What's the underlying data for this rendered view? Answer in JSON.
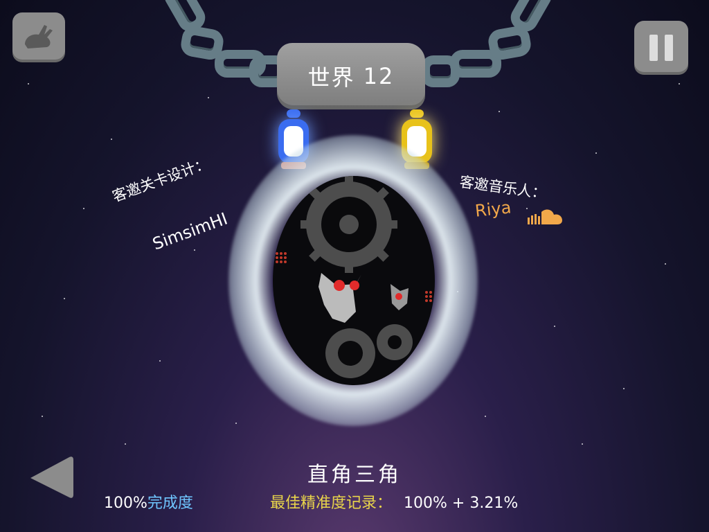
{
  "world_sign": {
    "label": "世界",
    "number": "12"
  },
  "credits": {
    "level_design_label": "客邀关卡设计：",
    "level_designer": "SimsimHI",
    "music_label": "客邀音乐人：",
    "musician": "Riya"
  },
  "level": {
    "name": "直角三角",
    "completion_value": "100%",
    "completion_label": "完成度",
    "best_accuracy_label": "最佳精准度记录：",
    "best_accuracy_value": "100% + 3.21%"
  },
  "icons": {
    "top_left": "rabbit-icon",
    "top_right": "pause-icon",
    "bottom_left": "back-arrow-icon",
    "music_service": "soundcloud-icon"
  },
  "colors": {
    "blue_lantern": "#3a6cf0",
    "yellow_lantern": "#e8c21a",
    "accent_blue": "#6fc6ff",
    "accent_yellow": "#e9d54a",
    "accent_orange": "#f2a84a"
  }
}
